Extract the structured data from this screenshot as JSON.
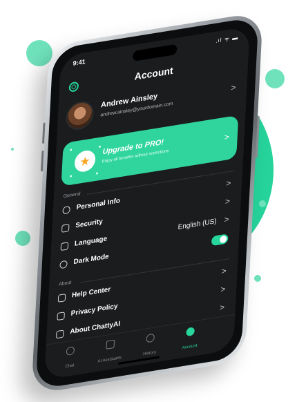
{
  "status": {
    "time": "9:41",
    "icons": ".ıl ᯤ ▬"
  },
  "header": {
    "title": "Account",
    "logo_icon": "chatgpt-logo-icon"
  },
  "profile": {
    "name": "Andrew Ainsley",
    "email": "andrew.ainsley@yourdomain.com",
    "chevron": ">"
  },
  "pro": {
    "title": "Upgrade to PRO!",
    "subtitle": "Enjoy all benefits without restrictions",
    "chevron": ">"
  },
  "general": {
    "label": "General",
    "items": [
      {
        "label": "Personal Info",
        "icon": "person-icon",
        "chevron": ">"
      },
      {
        "label": "Security",
        "icon": "shield-icon",
        "chevron": ">"
      },
      {
        "label": "Language",
        "icon": "document-icon",
        "value": "English (US)",
        "chevron": ">"
      },
      {
        "label": "Dark Mode",
        "icon": "eye-icon",
        "toggle": true
      }
    ]
  },
  "about": {
    "label": "About",
    "items": [
      {
        "label": "Help Center",
        "icon": "help-document-icon",
        "chevron": ">"
      },
      {
        "label": "Privacy Policy",
        "icon": "lock-icon",
        "chevron": ">"
      },
      {
        "label": "About ChattyAI",
        "icon": "info-icon",
        "chevron": ">"
      }
    ]
  },
  "tabs": [
    {
      "label": "Chat",
      "icon": "chat-icon",
      "active": false
    },
    {
      "label": "AI Assistants",
      "icon": "grid-icon",
      "active": false
    },
    {
      "label": "History",
      "icon": "clock-icon",
      "active": false
    },
    {
      "label": "Account",
      "icon": "user-icon",
      "active": true
    }
  ],
  "colors": {
    "accent": "#27d69b",
    "screen_bg": "#1b1c1e",
    "star": "#f6a623"
  }
}
